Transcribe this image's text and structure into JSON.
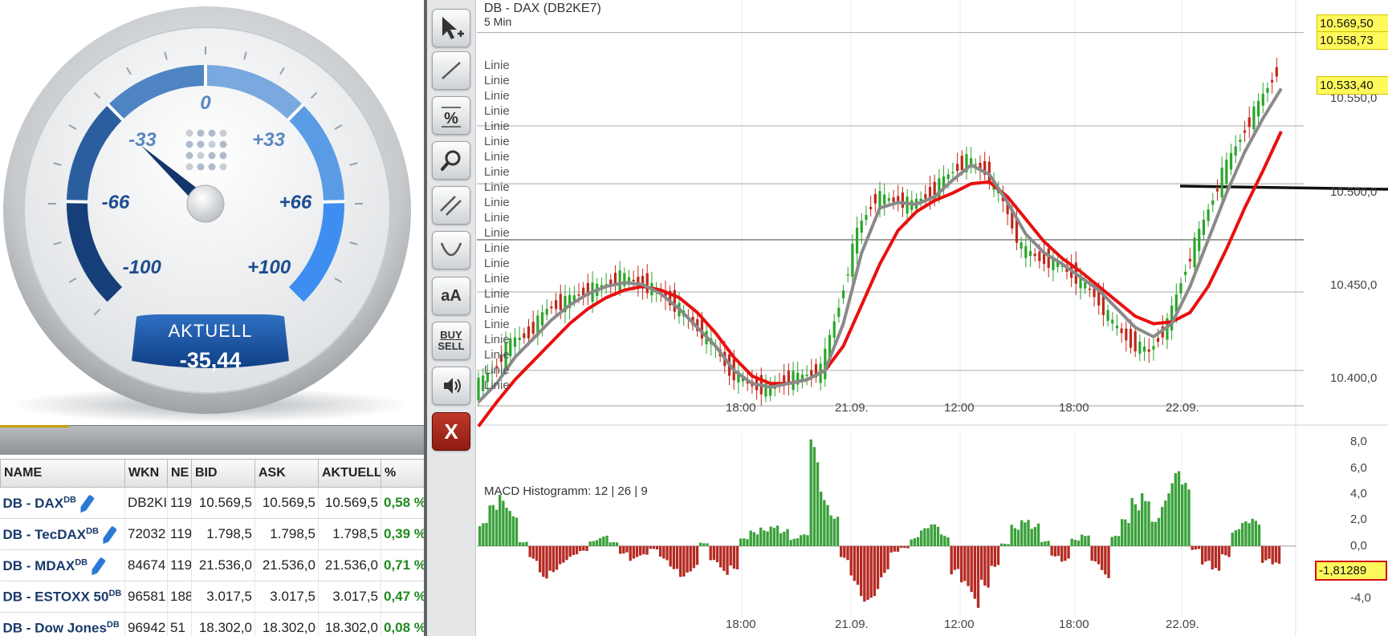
{
  "gauge": {
    "value": -35.44,
    "value_label": "-35,44",
    "badge_label": "AKTUELL",
    "scale": {
      "min": -100,
      "max": 100
    },
    "ticks": [
      {
        "label": "-100",
        "v": -100
      },
      {
        "label": "-66",
        "v": -66
      },
      {
        "label": "-33",
        "v": -33
      },
      {
        "label": "0",
        "v": 0
      },
      {
        "label": "+33",
        "v": 33
      },
      {
        "label": "+66",
        "v": 66
      },
      {
        "label": "+100",
        "v": 100
      }
    ]
  },
  "watchlist": {
    "columns": [
      "NAME",
      "WKN",
      "NE",
      "BID",
      "ASK",
      "AKTUELL",
      "%"
    ],
    "rows": [
      {
        "name": "DB - DAX",
        "sup": "DB",
        "edit": true,
        "wkn": "DB2KI",
        "ne": "119",
        "bid": "10.569,5",
        "ask": "10.569,5",
        "aktuell": "10.569,5",
        "pct": "0,58 %"
      },
      {
        "name": "DB - TecDAX",
        "sup": "DB",
        "edit": true,
        "wkn": "72032",
        "ne": "119",
        "bid": "1.798,5",
        "ask": "1.798,5",
        "aktuell": "1.798,5",
        "pct": "0,39 %"
      },
      {
        "name": "DB - MDAX",
        "sup": "DB",
        "edit": true,
        "wkn": "84674",
        "ne": "119",
        "bid": "21.536,0",
        "ask": "21.536,0",
        "aktuell": "21.536,0",
        "pct": "0,71 %"
      },
      {
        "name": "DB - ESTOXX 50",
        "sup": "DB",
        "edit": false,
        "wkn": "96581",
        "ne": "188",
        "bid": "3.017,5",
        "ask": "3.017,5",
        "aktuell": "3.017,5",
        "pct": "0,47 %"
      },
      {
        "name": "DB - Dow Jones",
        "sup": "DB",
        "edit": false,
        "wkn": "96942",
        "ne": "51",
        "bid": "18.302,0",
        "ask": "18.302,0",
        "aktuell": "18.302,0",
        "pct": "0,08 %"
      }
    ]
  },
  "toolbar": {
    "tools": [
      {
        "id": "cursor",
        "icon": "cursor-plus-icon"
      },
      {
        "id": "line",
        "icon": "trend-line-icon"
      },
      {
        "id": "percent",
        "icon": "percent-line-icon"
      },
      {
        "id": "zoom",
        "icon": "magnifier-icon"
      },
      {
        "id": "channel",
        "icon": "parallel-lines-icon"
      },
      {
        "id": "arc",
        "icon": "arc-icon"
      },
      {
        "id": "text",
        "icon": "text-icon",
        "label": "aA"
      },
      {
        "id": "buysell",
        "icon": "buy-sell-icon",
        "label1": "BUY",
        "label2": "SELL"
      },
      {
        "id": "sound",
        "icon": "speaker-icon"
      },
      {
        "id": "close",
        "icon": "close-icon",
        "label": "X"
      }
    ]
  },
  "chart_data": [
    {
      "type": "line",
      "subtype": "candlestick",
      "title": "DB - DAX (DB2KE7)",
      "subtitle": "5 Min",
      "x_tick_labels": [
        "18:00",
        "21.09.",
        "12:00",
        "18:00",
        "22.09."
      ],
      "y_ticks": [
        "10.550,0",
        "10.500,0",
        "10.450,0",
        "10.400,0"
      ],
      "ylim": [
        10380,
        10600
      ],
      "price_labels": [
        {
          "text": "10.569,50",
          "style": "yellow"
        },
        {
          "text": "10.558,73",
          "style": "yellow"
        },
        {
          "text": "10.533,40",
          "style": "yellow"
        }
      ],
      "line_labels": [
        "Linie",
        "Linie",
        "Linie",
        "Linie",
        "Linie",
        "Linie",
        "Linie",
        "Linie",
        "Linie",
        "Linie",
        "Linie",
        "Linie",
        "Linie",
        "Linie",
        "Linie",
        "Linie",
        "Linie",
        "Linie",
        "Linie",
        "Linie",
        "Linie",
        "Linie"
      ],
      "horizontal_levels": [
        10586,
        10536,
        10505,
        10475,
        10447,
        10405,
        10386
      ],
      "series": [
        {
          "name": "price",
          "color": "#2aa62a",
          "values": [
            10395,
            10405,
            10420,
            10425,
            10438,
            10442,
            10447,
            10450,
            10455,
            10452,
            10448,
            10440,
            10430,
            10420,
            10405,
            10398,
            10395,
            10400,
            10402,
            10405,
            10440,
            10480,
            10498,
            10496,
            10494,
            10500,
            10510,
            10518,
            10512,
            10495,
            10470,
            10465,
            10462,
            10455,
            10445,
            10430,
            10420,
            10415,
            10430,
            10460,
            10485,
            10510,
            10530,
            10548,
            10566
          ]
        },
        {
          "name": "ma-fast",
          "color": "#8a8a8a",
          "values": [
            10388,
            10398,
            10412,
            10422,
            10432,
            10440,
            10446,
            10450,
            10452,
            10451,
            10446,
            10438,
            10428,
            10418,
            10405,
            10398,
            10396,
            10398,
            10400,
            10405,
            10430,
            10468,
            10492,
            10495,
            10494,
            10498,
            10507,
            10515,
            10510,
            10495,
            10478,
            10468,
            10462,
            10455,
            10448,
            10438,
            10428,
            10423,
            10430,
            10450,
            10475,
            10500,
            10522,
            10540,
            10556
          ]
        },
        {
          "name": "ma-slow",
          "color": "#e81010",
          "values": [
            10375,
            10388,
            10400,
            10410,
            10420,
            10430,
            10438,
            10444,
            10448,
            10450,
            10448,
            10444,
            10436,
            10425,
            10412,
            10402,
            10398,
            10398,
            10400,
            10405,
            10418,
            10440,
            10462,
            10480,
            10490,
            10496,
            10500,
            10505,
            10506,
            10498,
            10486,
            10474,
            10465,
            10458,
            10450,
            10442,
            10434,
            10430,
            10431,
            10436,
            10450,
            10470,
            10492,
            10512,
            10533
          ]
        }
      ]
    },
    {
      "type": "bar",
      "title": "MACD Histogramm: 12 | 26 | 9",
      "x_tick_labels": [
        "18:00",
        "21.09.",
        "12:00",
        "18:00",
        "22.09."
      ],
      "y_ticks": [
        "8,0",
        "6,0",
        "4,0",
        "2,0",
        "0,0",
        "-4,0"
      ],
      "ylim": [
        -5.5,
        9
      ],
      "current_label": "-1,81289",
      "values": [
        1.8,
        3.2,
        4.0,
        3.1,
        0.4,
        -1.2,
        -2.5,
        -2.0,
        -1.4,
        -0.9,
        -0.5,
        0.5,
        0.8,
        0.3,
        -0.6,
        -1.2,
        -0.9,
        -0.3,
        -1.1,
        -1.8,
        -2.4,
        -2.0,
        0.3,
        -1.5,
        -2.3,
        -1.8,
        0.6,
        1.2,
        1.6,
        2.0,
        1.4,
        0.6,
        0.9,
        8.2,
        4.5,
        3.0,
        -1.2,
        -3.0,
        -4.3,
        -4.0,
        -2.5,
        -0.6,
        -0.2,
        0.7,
        1.4,
        1.7,
        0.9,
        -2.5,
        -3.8,
        -5.0,
        -3.2,
        -1.6,
        0.2,
        1.8,
        2.6,
        1.9,
        0.4,
        -0.8,
        -1.2,
        0.6,
        1.1,
        -1.6,
        -2.5,
        0.8,
        2.1,
        3.8,
        4.8,
        2.6,
        4.2,
        5.8,
        4.9,
        -0.3,
        -1.6,
        -2.4,
        -0.9,
        1.3,
        1.9,
        2.1,
        -1.4,
        -1.8
      ]
    }
  ]
}
